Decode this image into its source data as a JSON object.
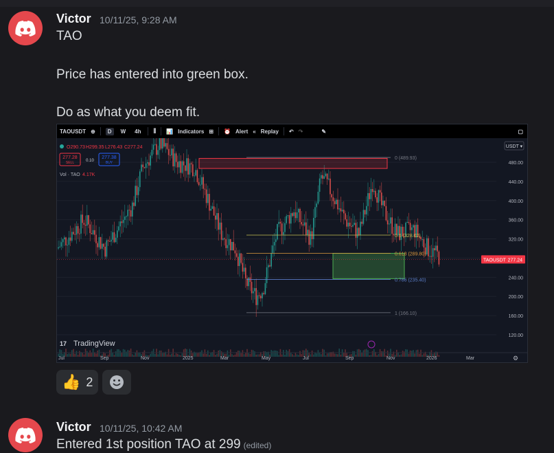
{
  "messages": [
    {
      "author": "Victor",
      "timestamp": "10/11/25, 9:28 AM",
      "lines": [
        "TAO",
        "Price has entered into green box.",
        "Do as what you deem fit."
      ],
      "reactions": [
        {
          "emoji": "👍",
          "count": "2"
        }
      ]
    },
    {
      "author": "Victor",
      "timestamp": "10/11/25, 10:42 AM",
      "text": "Entered 1st position TAO at 299",
      "edited": "(edited)"
    }
  ],
  "chart": {
    "symbol": "TAOUSDT",
    "timeframes": [
      "D",
      "W",
      "4h"
    ],
    "active_timeframe": "D",
    "toolbar": {
      "indicators": "Indicators",
      "alert": "Alert",
      "replay": "Replay"
    },
    "ohlc": {
      "o": "O290.73",
      "h": "H299.35",
      "l": "L276.43",
      "c": "C277.24"
    },
    "sell": {
      "price": "277.28",
      "label": "SELL"
    },
    "buy": {
      "price": "277.38",
      "label": "BUY"
    },
    "spread": "0.10",
    "volume_label": "Vol · TAO",
    "volume_value": "4.17K",
    "currency": "USDT",
    "price_tag": {
      "symbol": "TAOUSDT",
      "value": "277.24"
    },
    "watermark": "TradingView",
    "y_ticks": [
      480,
      440,
      400,
      360,
      320,
      280,
      240,
      200,
      160,
      120
    ],
    "x_ticks": [
      "Jul",
      "Sep",
      "Nov",
      "2025",
      "Mar",
      "May",
      "Jul",
      "Sep",
      "Nov",
      "2026",
      "Mar"
    ],
    "fib_levels": [
      {
        "label": "0 (489.93)",
        "price": 489.93,
        "color": "#787b86"
      },
      {
        "label": "0.5 (328.02)",
        "price": 328.02,
        "color": "#c9c355"
      },
      {
        "label": "0.618 (289.80)",
        "price": 289.8,
        "color": "#e09b3d"
      },
      {
        "label": "0.786 (235.40)",
        "price": 235.4,
        "color": "#5b7ec9"
      },
      {
        "label": "1 (166.10)",
        "price": 166.1,
        "color": "#787b86"
      }
    ],
    "red_box": {
      "top": 488,
      "bottom": 467
    },
    "green_box": {
      "top": 290,
      "bottom": 237
    },
    "current_price": 277.24,
    "colors": {
      "up": "#26a69a",
      "down": "#ef5350",
      "bg": "#131722"
    }
  }
}
